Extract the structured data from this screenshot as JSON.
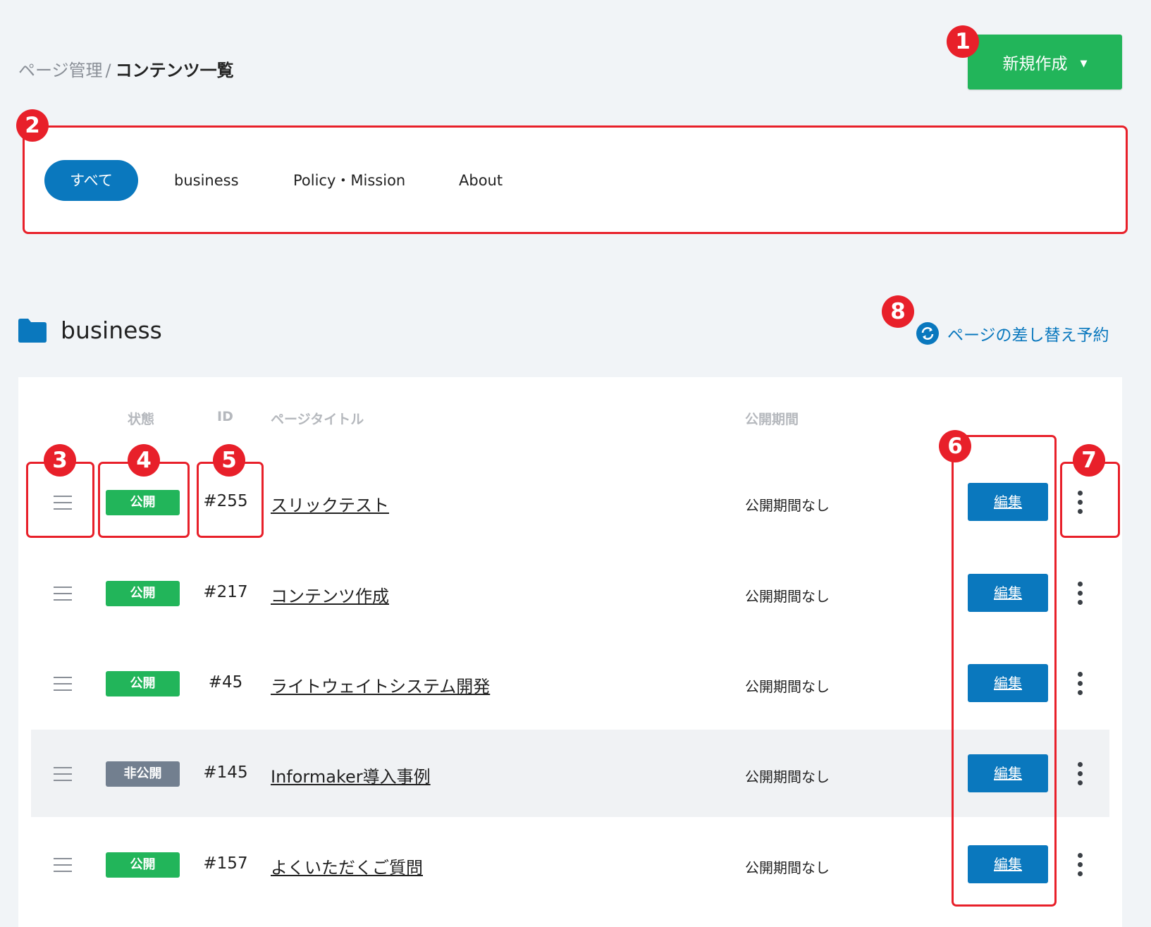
{
  "breadcrumb": {
    "parent": "ページ管理",
    "separator": "/",
    "current": "コンテンツ一覧"
  },
  "new_button": {
    "label": "新規作成",
    "caret": "▼"
  },
  "tabs": [
    {
      "label": "すべて",
      "active": true
    },
    {
      "label": "business",
      "active": false
    },
    {
      "label": "Policy・Mission",
      "active": false
    },
    {
      "label": "About",
      "active": false
    }
  ],
  "section": {
    "icon": "folder-icon",
    "title": "business",
    "swap_link": "ページの差し替え予約",
    "swap_icon": "refresh-icon"
  },
  "table": {
    "headers": {
      "status": "状態",
      "id": "ID",
      "title": "ページタイトル",
      "period": "公開期間"
    },
    "rows": [
      {
        "status": "公開",
        "status_type": "public",
        "id": "#255",
        "title": "スリックテスト",
        "period": "公開期間なし",
        "edit": "編集"
      },
      {
        "status": "公開",
        "status_type": "public",
        "id": "#217",
        "title": "コンテンツ作成",
        "period": "公開期間なし",
        "edit": "編集"
      },
      {
        "status": "公開",
        "status_type": "public",
        "id": "#45",
        "title": "ライトウェイトシステム開発",
        "period": "公開期間なし",
        "edit": "編集"
      },
      {
        "status": "非公開",
        "status_type": "private",
        "id": "#145",
        "title": "Informaker導入事例",
        "period": "公開期間なし",
        "edit": "編集"
      },
      {
        "status": "公開",
        "status_type": "public",
        "id": "#157",
        "title": "よくいただくご質問",
        "period": "公開期間なし",
        "edit": "編集"
      }
    ]
  },
  "annotations": [
    "1",
    "2",
    "3",
    "4",
    "5",
    "6",
    "7",
    "8"
  ],
  "colors": {
    "accent_blue": "#0a78be",
    "public_green": "#22b55a",
    "private_gray": "#727f8f",
    "annotation_red": "#e8202a"
  }
}
